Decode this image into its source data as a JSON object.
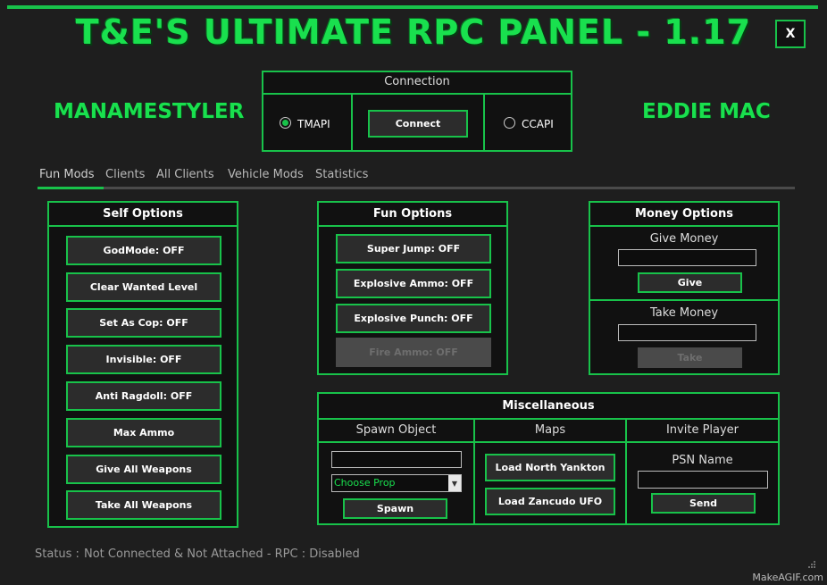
{
  "window": {
    "title": "T&E'S ULTIMATE RPC PANEL - 1.17",
    "close_label": "X"
  },
  "names": {
    "left": "MANAMESTYLER",
    "right": "EDDIE MAC"
  },
  "connection": {
    "header": "Connection",
    "tmapi_label": "TMAPI",
    "tmapi_selected": true,
    "connect_label": "Connect",
    "ccapi_label": "CCAPI",
    "ccapi_selected": false
  },
  "tabs": [
    {
      "label": "Fun Mods",
      "active": true
    },
    {
      "label": "Clients",
      "active": false
    },
    {
      "label": "All Clients",
      "active": false
    },
    {
      "label": "Vehicle Mods",
      "active": false
    },
    {
      "label": "Statistics",
      "active": false
    }
  ],
  "self_options": {
    "header": "Self Options",
    "buttons": [
      "GodMode: OFF",
      "Clear Wanted Level",
      "Set As Cop: OFF",
      "Invisible: OFF",
      "Anti Ragdoll: OFF",
      "Max Ammo",
      "Give All Weapons",
      "Take All Weapons"
    ]
  },
  "fun_options": {
    "header": "Fun Options",
    "buttons": [
      "Super Jump: OFF",
      "Explosive Ammo: OFF",
      "Explosive Punch: OFF"
    ],
    "disabled_button": "Fire Ammo: OFF"
  },
  "money_options": {
    "header": "Money Options",
    "give_label": "Give Money",
    "give_value": "",
    "give_button": "Give",
    "take_label": "Take Money",
    "take_value": "",
    "take_button": "Take"
  },
  "misc": {
    "header": "Miscellaneous",
    "spawn_header": "Spawn Object",
    "spawn_value": "",
    "prop_select": "Choose Prop",
    "spawn_button": "Spawn",
    "maps_header": "Maps",
    "map_buttons": [
      "Load North Yankton",
      "Load Zancudo UFO"
    ],
    "invite_header": "Invite Player",
    "psn_label": "PSN Name",
    "psn_value": "",
    "send_button": "Send"
  },
  "status": {
    "label": "Status :",
    "text": "Not Connected & Not Attached - RPC : Disabled"
  },
  "watermark": "MakeAGIF.com",
  "colors": {
    "accent": "#18c24a",
    "title": "#19e04e",
    "background": "#1e1e1e"
  }
}
